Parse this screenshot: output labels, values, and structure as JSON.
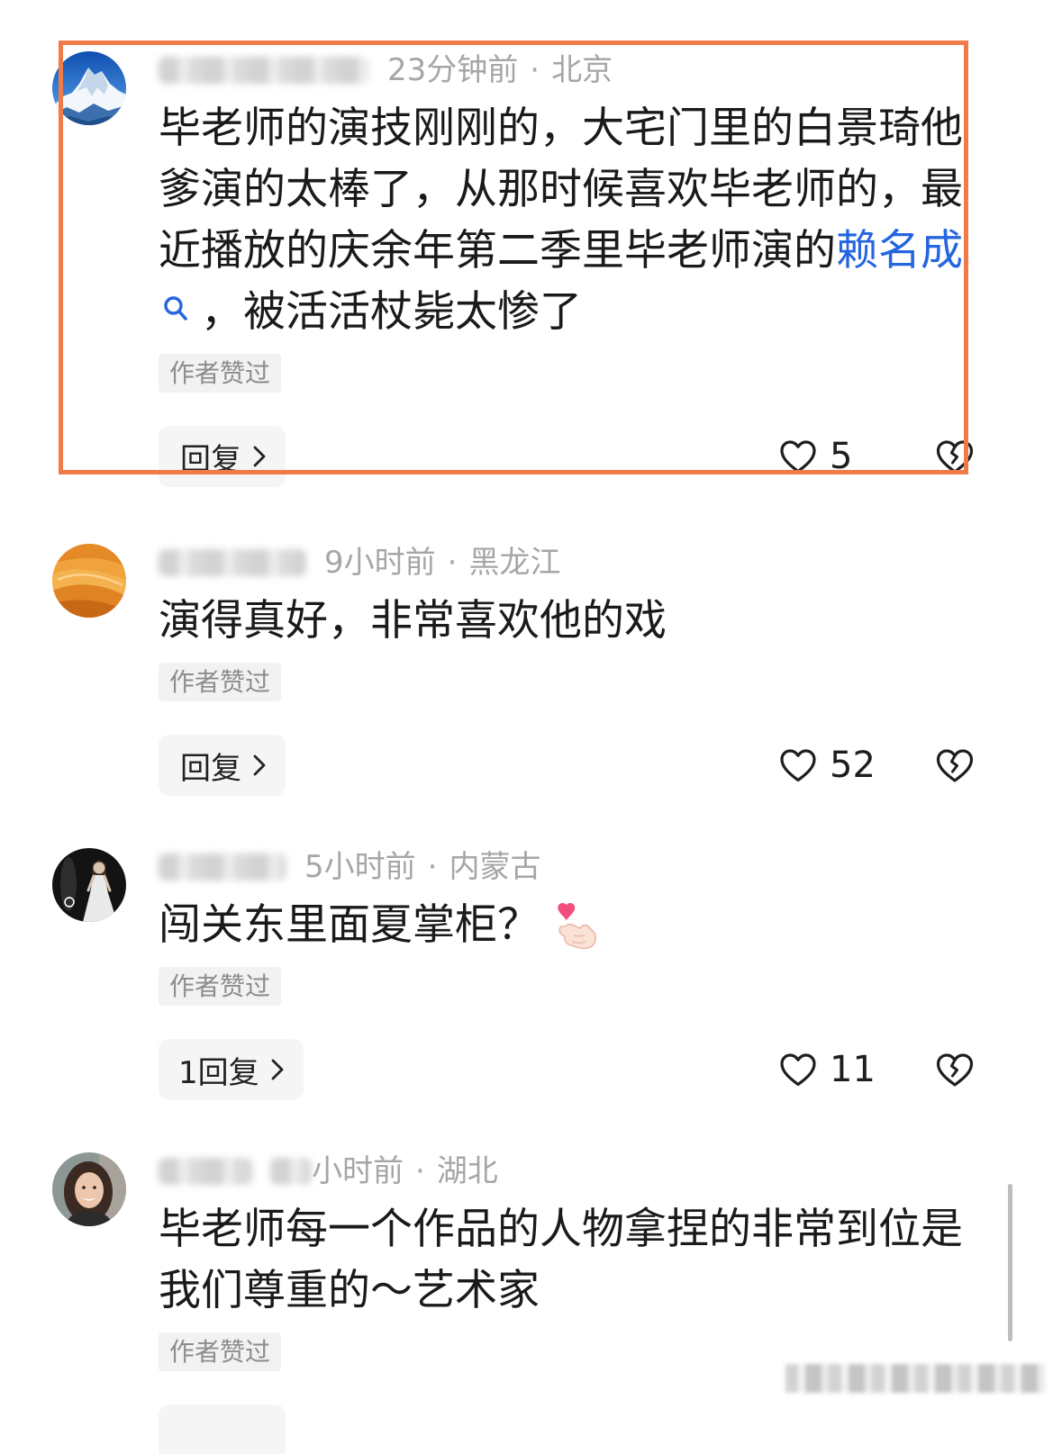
{
  "ui": {
    "separator": "·"
  },
  "colors": {
    "hl": "#F07A48",
    "link": "#2465E0",
    "txt": "#1A1A1A",
    "meta": "#A6A6A6"
  },
  "icons": [
    "search-icon",
    "heart-icon",
    "broken-heart-icon",
    "chevron-right-icon",
    "finger-heart-icon"
  ],
  "comments": [
    {
      "time": "23分钟前",
      "location": "北京",
      "text": "毕老师的演技刚刚的，大宅门里的白景琦他爹演的太棒了，从那时候喜欢毕老师的，最近播放的庆余年第二季里毕老师演的",
      "link": "赖名成",
      "link_icon": "search-icon",
      "text_after": "，被活活杖毙太惨了",
      "badge": "作者赞过",
      "reply_label": "回复",
      "likes": "5"
    },
    {
      "time": "9小时前",
      "location": "黑龙江",
      "text": "演得真好，非常喜欢他的戏",
      "badge": "作者赞过",
      "reply_label": "回复",
      "likes": "52"
    },
    {
      "time": "5小时前",
      "location": "内蒙古",
      "text": "闯关东里面夏掌柜？",
      "emoji_icon": "finger-heart-icon",
      "badge": "作者赞过",
      "reply_label": "1回复",
      "likes": "11"
    },
    {
      "time": "小时前",
      "location": "湖北",
      "text": "毕老师每一个作品的人物拿捏的非常到位是我们尊重的～艺术家",
      "badge": "作者赞过"
    }
  ]
}
